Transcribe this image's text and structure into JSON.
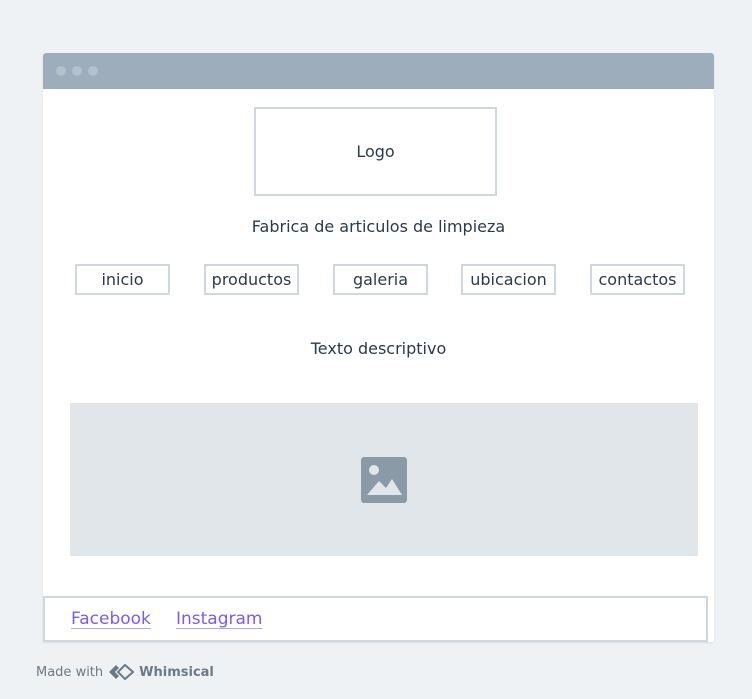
{
  "window": {
    "titlebar_dots": 3
  },
  "header": {
    "logo_label": "Logo",
    "subtitle": "Fabrica de articulos de limpieza"
  },
  "nav": {
    "items": [
      {
        "label": "inicio"
      },
      {
        "label": "productos"
      },
      {
        "label": "galeria"
      },
      {
        "label": "ubicacion"
      },
      {
        "label": "contactos"
      }
    ]
  },
  "main": {
    "description": "Texto descriptivo",
    "image_icon": "image-icon"
  },
  "footer": {
    "links": [
      {
        "label": "Facebook"
      },
      {
        "label": "Instagram"
      }
    ]
  },
  "credit": {
    "prefix": "Made with",
    "brand": "Whimsical",
    "brand_icon": "whimsical-logo-icon"
  },
  "colors": {
    "background": "#eef2f5",
    "titlebar": "#9dadbb",
    "border": "#cfd8df",
    "placeholder": "#e1e6ea",
    "link": "#7c5ce8",
    "text": "#2b3a4a"
  }
}
